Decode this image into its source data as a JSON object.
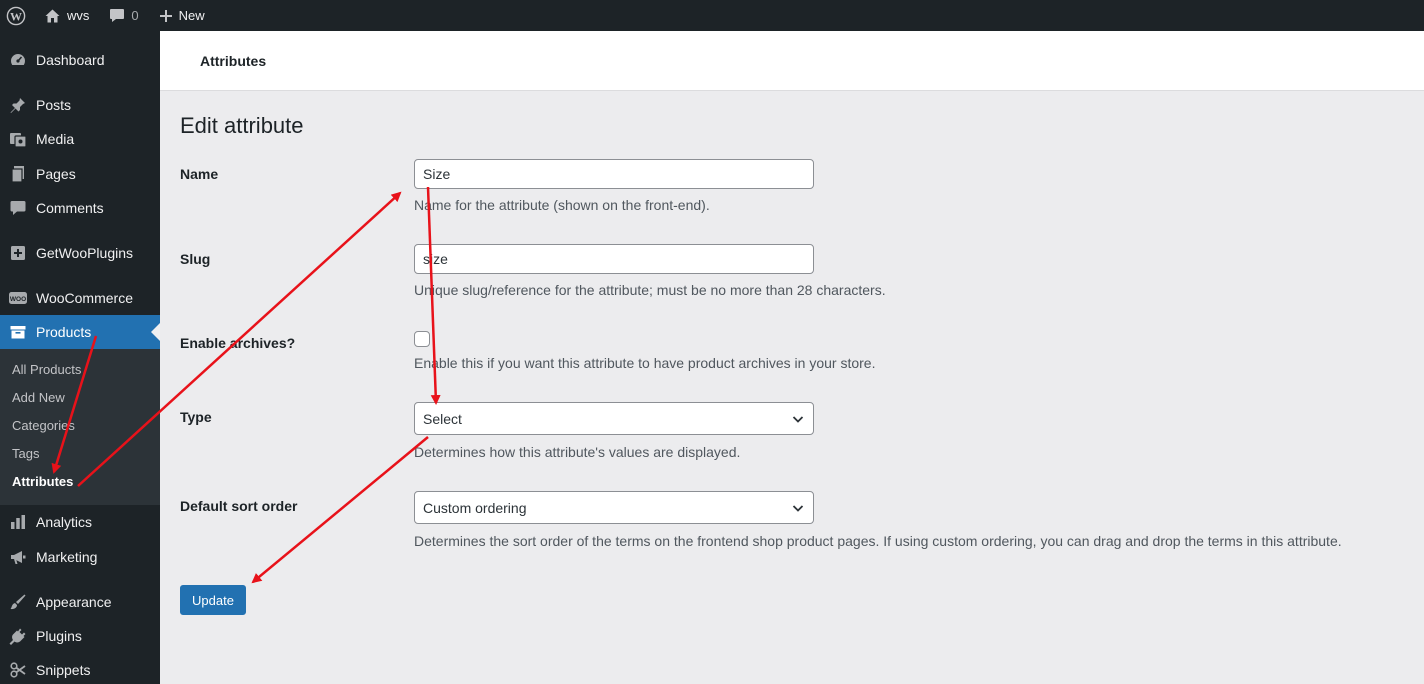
{
  "admin_bar": {
    "site_name": "wvs",
    "comment_count": "0",
    "new_label": "New",
    "icons": [
      "wordpress-logo-icon",
      "home-icon",
      "comment-bubble-icon",
      "plus-icon"
    ]
  },
  "sidebar": {
    "items": [
      {
        "label": "Dashboard",
        "icon": "dashboard-icon"
      },
      {
        "label": "Posts",
        "icon": "pin-icon"
      },
      {
        "label": "Media",
        "icon": "media-icon"
      },
      {
        "label": "Pages",
        "icon": "pages-icon"
      },
      {
        "label": "Comments",
        "icon": "comment-icon"
      },
      {
        "label": "GetWooPlugins",
        "icon": "plugin-box-icon"
      },
      {
        "label": "WooCommerce",
        "icon": "woo-icon"
      },
      {
        "label": "Products",
        "icon": "archive-icon"
      },
      {
        "label": "Analytics",
        "icon": "bar-chart-icon"
      },
      {
        "label": "Marketing",
        "icon": "megaphone-icon"
      },
      {
        "label": "Appearance",
        "icon": "brush-icon"
      },
      {
        "label": "Plugins",
        "icon": "plug-icon"
      },
      {
        "label": "Snippets",
        "icon": "snippets-icon"
      }
    ],
    "submenu": [
      {
        "label": "All Products"
      },
      {
        "label": "Add New"
      },
      {
        "label": "Categories"
      },
      {
        "label": "Tags"
      },
      {
        "label": "Attributes"
      }
    ],
    "current_item": "Products",
    "current_subitem": "Attributes"
  },
  "header": {
    "title": "Attributes"
  },
  "form": {
    "page_title": "Edit attribute",
    "name": {
      "label": "Name",
      "value": "Size",
      "description": "Name for the attribute (shown on the front-end)."
    },
    "slug": {
      "label": "Slug",
      "value": "size",
      "description": "Unique slug/reference for the attribute; must be no more than 28 characters."
    },
    "archives": {
      "label": "Enable archives?",
      "checked": false,
      "description": "Enable this if you want this attribute to have product archives in your store."
    },
    "type": {
      "label": "Type",
      "value": "Select",
      "description": "Determines how this attribute's values are displayed."
    },
    "sort_order": {
      "label": "Default sort order",
      "value": "Custom ordering",
      "description": "Determines the sort order of the terms on the frontend shop product pages. If using custom ordering, you can drag and drop the terms in this attribute."
    },
    "submit_label": "Update"
  },
  "colors": {
    "admin_dark": "#1d2327",
    "submenu_bg": "#2c3338",
    "accent": "#2271b1",
    "annotation_arrow": "#e8121a"
  }
}
